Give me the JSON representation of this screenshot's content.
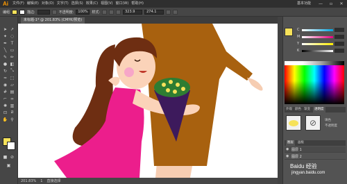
{
  "app": {
    "logo": "Ai",
    "title": "基本功能",
    "window_controls": [
      "—",
      "▫",
      "✕"
    ]
  },
  "menus": [
    "文件(F)",
    "编辑(E)",
    "对象(O)",
    "文字(T)",
    "选择(S)",
    "效果(C)",
    "视图(V)",
    "窗口(W)",
    "帮助(H)"
  ],
  "control_bar": {
    "label": "编组",
    "stroke_label": "描边:",
    "width_field": "",
    "opacity_label": "不透明度:",
    "opacity_value": "100%",
    "style_label": "样式:",
    "x_value": "323.9",
    "y_value": "274.1"
  },
  "doc_tab": {
    "label": "未标题-1* @ 201.83% (CMYK/预览)"
  },
  "status_bar": {
    "zoom": "201.83%",
    "page": "1",
    "tool": "直接选择"
  },
  "colors": {
    "fill": "#f6e25a",
    "stroke": "#ffffff",
    "canvas": "#ffffff",
    "coat": "#a8610f",
    "hair": "#6e2e12",
    "dress": "#ec1e8c",
    "skin": "#fbd3b9",
    "bouquet_wrap": "#3d1a5c"
  },
  "color_panel": {
    "sliders": [
      {
        "label": "C",
        "value": ""
      },
      {
        "label": "M",
        "value": ""
      },
      {
        "label": "Y",
        "value": ""
      },
      {
        "label": "K",
        "value": ""
      }
    ]
  },
  "appearance_tabs": [
    "外观",
    "颜色",
    "渐变",
    "透明度"
  ],
  "appearance": {
    "fill_label": "填色",
    "stroke_label": "不透明度"
  },
  "layers": {
    "tabs": [
      "图层",
      "画板"
    ],
    "rows": [
      {
        "name": "图层 1"
      },
      {
        "name": "图层 2"
      }
    ]
  },
  "watermark": {
    "line1": "Baidu 经验",
    "line2": "jingyan.baidu.com"
  }
}
